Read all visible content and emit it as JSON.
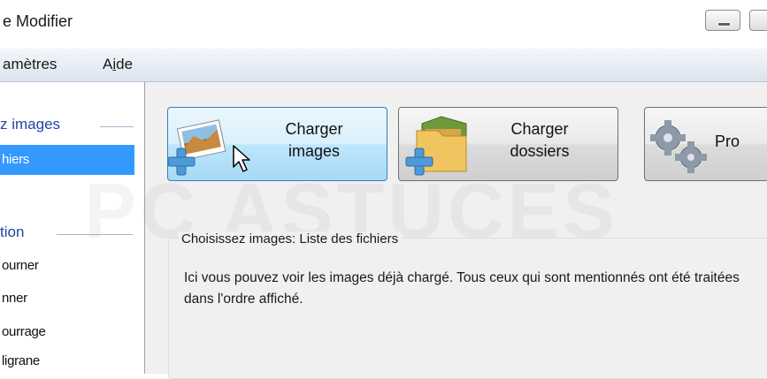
{
  "window": {
    "title": "e Modifier"
  },
  "menubar": {
    "items": [
      "amètres",
      "Aide"
    ]
  },
  "sidebar": {
    "group1_title": "z images",
    "group1_selected": "hiers",
    "group2_title": "tion",
    "items": [
      "ourner",
      "nner",
      "ourrage",
      "ligrane"
    ]
  },
  "toolbar": {
    "load_images": "Charger\nimages",
    "load_folders": "Charger\ndossiers",
    "process": "Pro"
  },
  "panel": {
    "title": "Choisissez images: Liste des fichiers",
    "description": "Ici vous pouvez voir les images déjà chargé. Tous ceux qui sont mentionnés ont été traitées dans l'ordre affiché."
  },
  "watermark": "PC ASTUCES",
  "colors": {
    "selection": "#3399ff",
    "group_header": "#1e46a3",
    "hover_button": "#bee6fd"
  }
}
